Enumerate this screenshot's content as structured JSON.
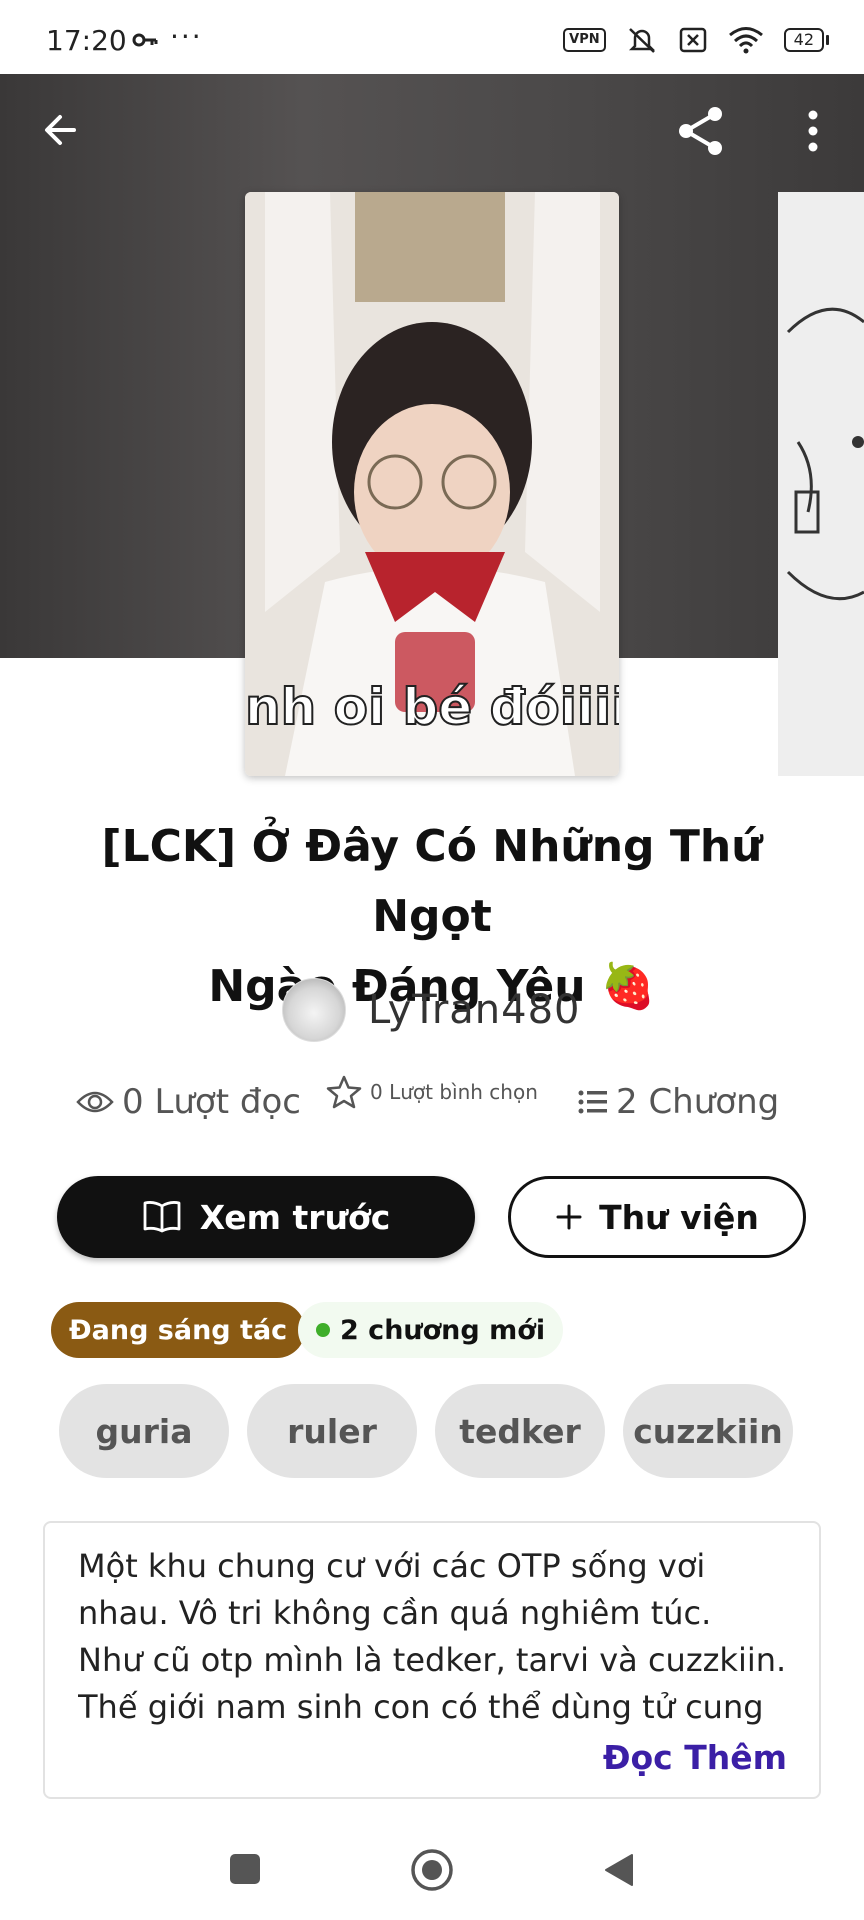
{
  "status_bar": {
    "time": "17:20",
    "dots": "···",
    "vpn": "VPN",
    "battery": "42"
  },
  "header": {
    "back_icon": "arrow-left-icon",
    "share_icon": "share-icon",
    "more_icon": "more-vertical-icon"
  },
  "cover": {
    "caption": "nh oi bé đóiiiiiiiiii"
  },
  "story": {
    "title_line1": "[LCK] Ở Đây Có Những Thứ Ngọt",
    "title_line2": "Ngào Đáng Yêu 🍓",
    "author": "LyTran480"
  },
  "stats": {
    "reads": "0 Lượt đọc",
    "votes": "0 Lượt bình chọn",
    "chapters": "2 Chương"
  },
  "actions": {
    "preview": "Xem trước",
    "library": "Thư viện"
  },
  "badges": {
    "status": "Đang sáng tác",
    "new_chapters": "2 chương mới"
  },
  "tags": [
    "guria",
    "ruler",
    "tedker",
    "cuzzkiin"
  ],
  "description": {
    "line1": "Một khu chung cư với các OTP sống vơi",
    "line2": "nhau. Vô tri không cần quá nghiêm túc.",
    "line3": "Như cũ otp mình là tedker, tarvi và cuzzkiin.",
    "line4": "Thế giới nam sinh con có thể dùng tử cung",
    "read_more": "Đọc Thêm"
  },
  "colors": {
    "accent_purple": "#3b1fa6",
    "status_brown": "#8a5a13",
    "new_green": "#3fae2a"
  }
}
